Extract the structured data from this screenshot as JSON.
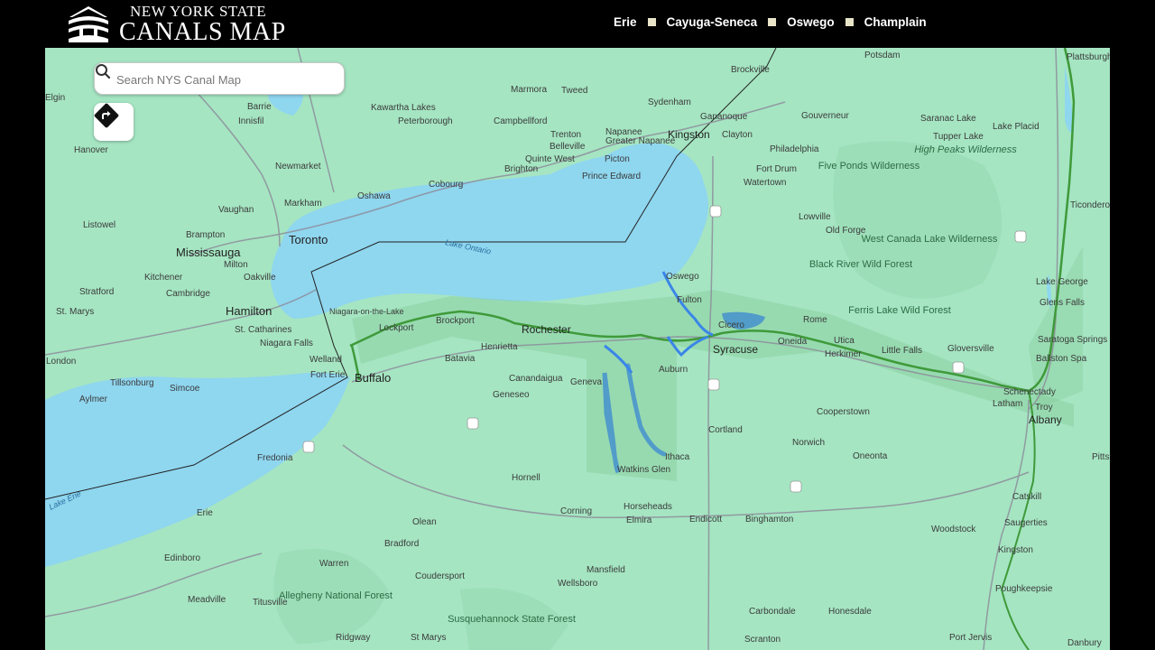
{
  "header": {
    "logo_line1": "NEW YORK STATE",
    "logo_line2": "CANALS MAP",
    "nav": [
      "Erie",
      "Cayuga-Seneca",
      "Oswego",
      "Champlain"
    ]
  },
  "search": {
    "placeholder": "Search NYS Canal Map"
  },
  "icons": {
    "search": "search-icon",
    "directions": "directions-icon"
  },
  "colors": {
    "land": "#a5e5c2",
    "water": "#8fd6ef",
    "canal": "#3f9a3a",
    "canal_lakes": "#3a86e8",
    "header": "#000000"
  },
  "map_labels": {
    "cities_major": [
      "Toronto",
      "Mississauga",
      "Hamilton",
      "Buffalo",
      "Rochester",
      "Syracuse",
      "Albany",
      "Kingston"
    ],
    "cities": [
      "Barrie",
      "Markham",
      "Oshawa",
      "Vaughan",
      "Brampton",
      "Oakville",
      "Kitchener",
      "Cambridge",
      "St. Catharines",
      "Niagara Falls",
      "Niagara-on-the-Lake",
      "Lockport",
      "Brockport",
      "Henrietta",
      "Batavia",
      "Fort Erie",
      "Welland",
      "Geneva",
      "Auburn",
      "Fulton",
      "Oswego",
      "Cicero",
      "Rome",
      "Utica",
      "Oneida",
      "Herkimer",
      "Little Falls",
      "Gloversville",
      "Saratoga Springs",
      "Ballston Spa",
      "Schenectady",
      "Latham",
      "Troy",
      "Ithaca",
      "Watkins Glen",
      "Cortland",
      "Norwich",
      "Oneonta",
      "Cooperstown",
      "Binghamton",
      "Endicott",
      "Elmira",
      "Horseheads",
      "Corning",
      "Hornell",
      "Olean",
      "Bradford",
      "Erie",
      "Fredonia",
      "Warren",
      "Coudersport",
      "Wellsboro",
      "Mansfield",
      "Canandaigua",
      "Geneseo",
      "Cobourg",
      "Belleville",
      "Quinte West",
      "Brighton",
      "Trenton",
      "Napanee",
      "Greater Napanee",
      "Picton",
      "Prince Edward",
      "Peterborough",
      "Campbellford",
      "Marmora",
      "Tweed",
      "Sydenham",
      "Gananoque",
      "Clayton",
      "Brockville",
      "Potsdam",
      "Gouverneur",
      "Philadelphia",
      "Fort Drum",
      "Watertown",
      "Lowville",
      "Old Forge",
      "Saranac Lake",
      "Lake Placid",
      "Tupper Lake",
      "Plattsburgh",
      "Ticonderoga",
      "Lake George",
      "Glens Falls",
      "Catskill",
      "Saugerties",
      "Kingston",
      "Poughkeepsie",
      "Woodstock",
      "Danbury",
      "Port Jervis",
      "Carbondale",
      "Honesdale",
      "Scranton",
      "St Marys",
      "Ridgway",
      "Meadville",
      "Titusville",
      "Edinboro",
      "London",
      "Tillsonburg",
      "Simcoe",
      "Aylmer",
      "St. Marys",
      "Stratford",
      "Listowel",
      "Hanover",
      "Elgin",
      "Kawartha Lakes",
      "Newmarket",
      "Milton",
      "Innisfil",
      "Pittsfield"
    ],
    "regions": [
      "Five Ponds Wilderness",
      "High Peaks Wilderness",
      "West Canada Lake Wilderness",
      "Black River Wild Forest",
      "Ferris Lake Wild Forest",
      "Allegheny National Forest",
      "Susquehannock State Forest"
    ],
    "water": [
      "Lake Ontario",
      "Lake Erie"
    ]
  }
}
